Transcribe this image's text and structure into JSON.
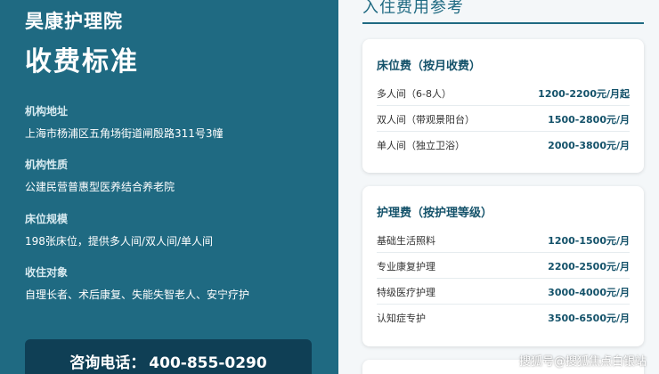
{
  "left": {
    "org_name": "昊康护理院",
    "title": "收费标准",
    "info": [
      {
        "label": "机构地址",
        "value": "上海市杨浦区五角场街道闸殷路311号3幢"
      },
      {
        "label": "机构性质",
        "value": "公建民营普惠型医养结合养老院"
      },
      {
        "label": "床位规模",
        "value": "198张床位，提供多人间/双人间/单人间"
      },
      {
        "label": "收住对象",
        "value": "自理长者、术后康复、失能失智老人、安宁疗护"
      }
    ],
    "phone_label": "咨询电话：",
    "phone_number": "400-855-0290"
  },
  "right": {
    "title": "入住费用参考",
    "cards": [
      {
        "title": "床位费（按月收费）",
        "rows": [
          {
            "name": "多人间（6-8人）",
            "price": "1200-2200元/月起"
          },
          {
            "name": "双人间（带观景阳台）",
            "price": "1500-2800元/月"
          },
          {
            "name": "单人间（独立卫浴）",
            "price": "2000-3800元/月"
          }
        ]
      },
      {
        "title": "护理费（按护理等级）",
        "rows": [
          {
            "name": "基础生活照料",
            "price": "1200-1500元/月"
          },
          {
            "name": "专业康复护理",
            "price": "2200-2500元/月"
          },
          {
            "name": "特级医疗护理",
            "price": "3000-4000元/月"
          },
          {
            "name": "认知症专护",
            "price": "3500-6500元/月"
          }
        ]
      }
    ]
  },
  "watermark": "搜狐号@搜狐焦点白银站",
  "colors": {
    "primary": "#1f6a82",
    "dark": "#0f3f55",
    "price": "#14526a"
  }
}
